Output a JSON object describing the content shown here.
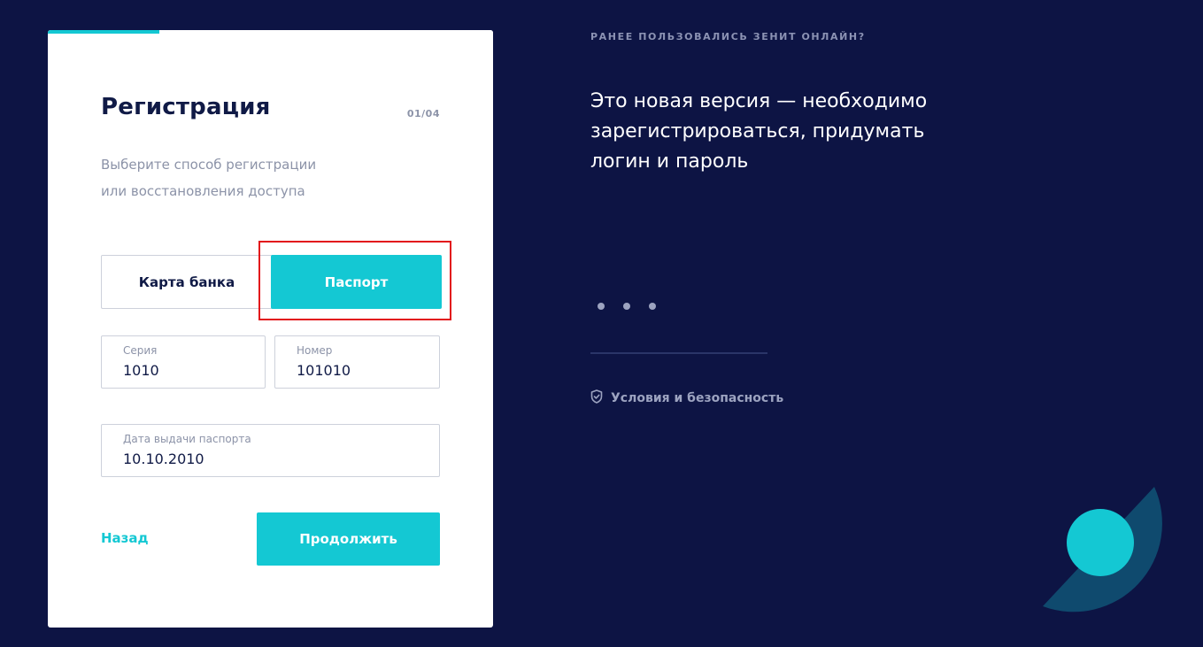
{
  "colors": {
    "background": "#0d1444",
    "accent": "#14c8d3",
    "text_dark": "#101a46",
    "text_muted": "#8c93a8",
    "highlight": "#e2151b"
  },
  "form": {
    "title": "Регистрация",
    "step": "01/04",
    "progress_fraction": 0.25,
    "subtitle_lines": [
      "Выберите способ регистрации",
      "или восстановления доступа"
    ],
    "method_options": [
      {
        "label": "Карта банка",
        "selected": false
      },
      {
        "label": "Паспорт",
        "selected": true
      }
    ],
    "fields": {
      "seria": {
        "label": "Серия",
        "value": "1010"
      },
      "nomer": {
        "label": "Номер",
        "value": "101010"
      },
      "issue_date": {
        "label": "Дата выдачи паспорта",
        "value": "10.10.2010"
      }
    },
    "back_label": "Назад",
    "continue_label": "Продолжить"
  },
  "info": {
    "eyebrow": "РАНЕЕ ПОЛЬЗОВАЛИСЬ ЗЕНИТ ОНЛАЙН?",
    "text_lines": [
      "Это новая версия — необходимо",
      "зарегистрироваться, придумать",
      "логин и пароль"
    ],
    "carousel_dots": 3,
    "terms_label": "Условия и безопасность",
    "terms_icon": "shield-check-icon"
  }
}
